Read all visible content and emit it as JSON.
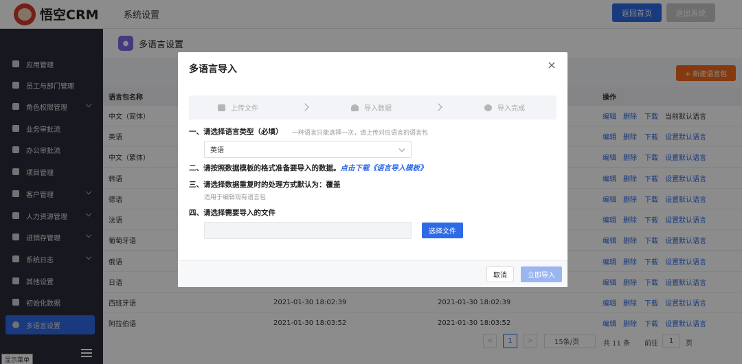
{
  "header": {
    "logo_text": "悟空CRM",
    "title": "系统设置",
    "back_home": "返回首页",
    "exit_system": "退出系统"
  },
  "sidebar": {
    "items": [
      {
        "label": "应用管理",
        "icon": "grid-icon",
        "expandable": false
      },
      {
        "label": "员工与部门管理",
        "icon": "users-icon",
        "expandable": false
      },
      {
        "label": "角色权限管理",
        "icon": "user-icon",
        "expandable": true
      },
      {
        "label": "业务审批流",
        "icon": "user-icon",
        "expandable": false
      },
      {
        "label": "办公审批流",
        "icon": "user-icon",
        "expandable": false
      },
      {
        "label": "项目管理",
        "icon": "list-icon",
        "expandable": false
      },
      {
        "label": "客户管理",
        "icon": "building-icon",
        "expandable": true
      },
      {
        "label": "人力资源管理",
        "icon": "users-icon",
        "expandable": true
      },
      {
        "label": "进销存管理",
        "icon": "chart-icon",
        "expandable": true
      },
      {
        "label": "系统日志",
        "icon": "log-icon",
        "expandable": true
      },
      {
        "label": "其他设置",
        "icon": "gear-icon",
        "expandable": false
      },
      {
        "label": "初始化数据",
        "icon": "bar-chart-icon",
        "expandable": false
      },
      {
        "label": "多语言设置",
        "icon": "chat-icon",
        "expandable": false,
        "active": true
      }
    ],
    "tooltip": "显示菜单"
  },
  "page": {
    "title": "多语言设置",
    "new_button": "+ 新建语言包"
  },
  "table": {
    "headers": {
      "name": "语言包名称",
      "ops": "操作"
    },
    "rows": [
      {
        "name": "中文（简体）",
        "created": "",
        "updated": "",
        "last": "当前默认语言"
      },
      {
        "name": "英语",
        "created": "",
        "updated": "",
        "last": "设置默认语言"
      },
      {
        "name": "中文（繁体）",
        "created": "",
        "updated": "",
        "last": "设置默认语言"
      },
      {
        "name": "韩语",
        "created": "",
        "updated": "",
        "last": "设置默认语言"
      },
      {
        "name": "德语",
        "created": "",
        "updated": "",
        "last": "设置默认语言"
      },
      {
        "name": "法语",
        "created": "",
        "updated": "",
        "last": "设置默认语言"
      },
      {
        "name": "葡萄牙语",
        "created": "",
        "updated": "",
        "last": "设置默认语言"
      },
      {
        "name": "俄语",
        "created": "",
        "updated": "",
        "last": "设置默认语言"
      },
      {
        "name": "日语",
        "created": "",
        "updated": "",
        "last": "设置默认语言"
      },
      {
        "name": "西班牙语",
        "created": "2021-01-30 18:02:39",
        "updated": "2021-01-30 18:02:39",
        "last": "设置默认语言"
      },
      {
        "name": "阿拉伯语",
        "created": "2021-01-30 18:03:52",
        "updated": "2021-01-30 18:03:52",
        "last": "设置默认语言"
      }
    ],
    "op_edit": "编辑",
    "op_delete": "删除",
    "op_download": "下载"
  },
  "pagination": {
    "current": "1",
    "page_size": "15条/页",
    "total": "共 11 条",
    "goto_label": "前往",
    "goto_value": "1",
    "page_unit": "页"
  },
  "dialog": {
    "title": "多语言导入",
    "steps": [
      "上传文件",
      "导入数据",
      "导入完成"
    ],
    "step1": {
      "label": "一、请选择语言类型（必填）",
      "hint": "一种语言只能选择一次，请上传对应语言的语言包",
      "selected": "英语"
    },
    "step2": {
      "label": "二、请按照数据模板的格式准备要导入的数据。",
      "link": "点击下载《语言导入模板》"
    },
    "step3": {
      "label": "三、请选择数据重复时的处理方式默认为：覆盖",
      "hint": "适用于编辑现有语言包"
    },
    "step4": {
      "label": "四、请选择需要导入的文件",
      "choose": "选择文件"
    },
    "cancel": "取消",
    "confirm": "立即导入"
  }
}
